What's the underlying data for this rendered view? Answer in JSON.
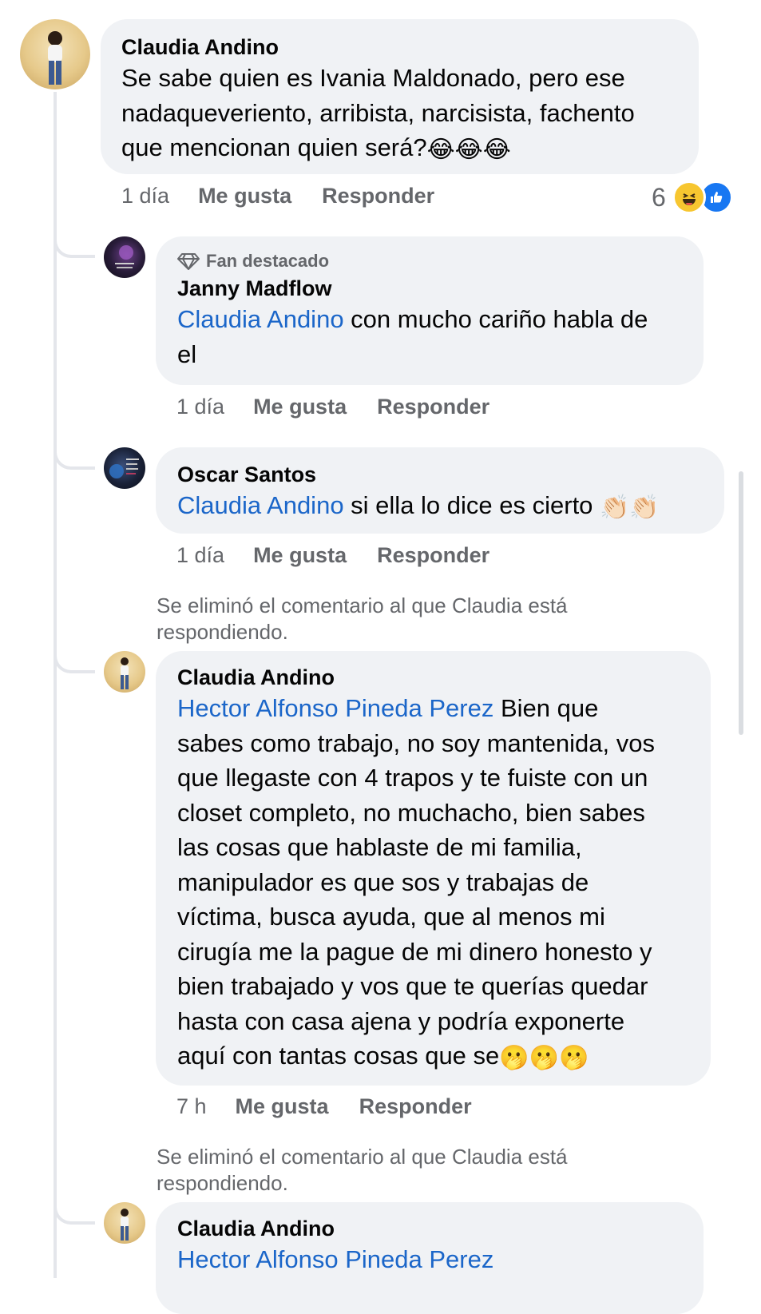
{
  "comments": [
    {
      "author": "Claudia Andino",
      "text_lines": [
        "Se sabe quien es Ivania Maldonado, pero ese",
        "nadaqueveriento, arribista, narcisista, fachento",
        "que mencionan quien será?"
      ],
      "emojis": "😂😂😂",
      "time": "1 día",
      "like_label": "Me gusta",
      "reply_label": "Responder",
      "reaction_count": "6"
    },
    {
      "badge": "Fan destacado",
      "author": "Janny Madflow",
      "mention": "Claudia Andino",
      "text_line1": " con mucho cariño habla de",
      "text_line2": "el",
      "time": "1 día",
      "like_label": "Me gusta",
      "reply_label": "Responder"
    },
    {
      "author": "Oscar Santos",
      "mention": "Claudia Andino",
      "text": " si ella lo dice es cierto ",
      "emojis": "👏🏻👏🏻",
      "time": "1 día",
      "like_label": "Me gusta",
      "reply_label": "Responder"
    },
    {
      "deleted_notice_lines": [
        "Se eliminó el comentario al que Claudia está",
        "respondiendo."
      ],
      "author": "Claudia Andino",
      "mention": "Hector Alfonso Pineda Perez",
      "first_line_rest": " Bien que",
      "text_lines": [
        "sabes como trabajo, no soy mantenida, vos",
        "que llegaste con 4 trapos y te fuiste con un",
        "closet completo, no muchacho, bien sabes",
        "las cosas que hablaste de mi familia,",
        "manipulador es que sos y trabajas de",
        "víctima, busca ayuda, que al menos mi",
        "cirugía me la pague de mi dinero honesto y",
        "bien trabajado y vos que te querías quedar",
        "hasta con casa ajena y podría exponerte"
      ],
      "last_line": "aquí con tantas cosas que se",
      "emojis": "🫢🫢🫢",
      "time": "7 h",
      "like_label": "Me gusta",
      "reply_label": "Responder"
    },
    {
      "deleted_notice_lines": [
        "Se eliminó el comentario al que Claudia está",
        "respondiendo."
      ],
      "author": "Claudia Andino",
      "mention": "Hector Alfonso Pineda Perez"
    }
  ],
  "icons": {
    "diamond": "diamond-icon",
    "haha": "haha-reaction-icon",
    "like": "like-reaction-icon"
  },
  "colors": {
    "mention": "#1b66c9",
    "bubble": "#f0f2f5",
    "meta": "#65676b",
    "like_blue": "#1877f2"
  }
}
